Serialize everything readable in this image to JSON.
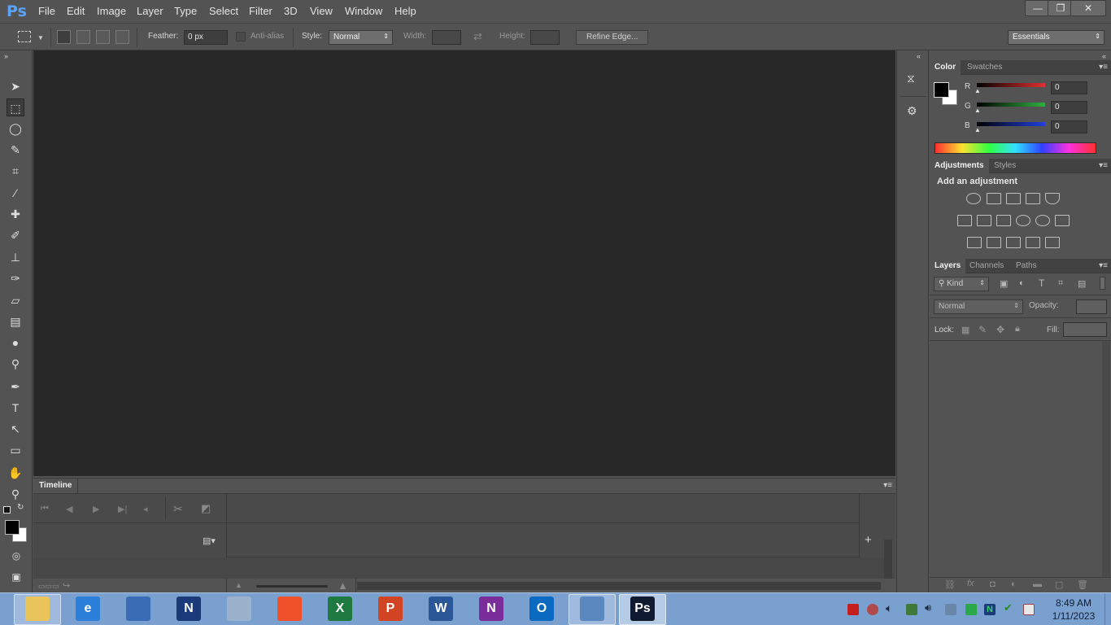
{
  "app": {
    "logo_text": "Ps"
  },
  "menu": [
    "File",
    "Edit",
    "Image",
    "Layer",
    "Type",
    "Select",
    "Filter",
    "3D",
    "View",
    "Window",
    "Help"
  ],
  "window_controls": {
    "minimize": "—",
    "restore": "❐",
    "close": "✕"
  },
  "options_bar": {
    "feather_label": "Feather:",
    "feather_value": "0 px",
    "antialias_label": "Anti-alias",
    "style_label": "Style:",
    "style_value": "Normal",
    "width_label": "Width:",
    "height_label": "Height:",
    "refine_edge": "Refine Edge...",
    "workspace": "Essentials"
  },
  "tools": [
    {
      "name": "move-tool-icon",
      "glyph": "➤"
    },
    {
      "name": "rect-marquee-tool-icon",
      "glyph": "⬚"
    },
    {
      "name": "lasso-tool-icon",
      "glyph": "◯"
    },
    {
      "name": "quick-select-tool-icon",
      "glyph": "✎"
    },
    {
      "name": "crop-tool-icon",
      "glyph": "⌗"
    },
    {
      "name": "eyedropper-tool-icon",
      "glyph": "⁄"
    },
    {
      "name": "healing-brush-tool-icon",
      "glyph": "✚"
    },
    {
      "name": "brush-tool-icon",
      "glyph": "✐"
    },
    {
      "name": "clone-stamp-tool-icon",
      "glyph": "⊥"
    },
    {
      "name": "history-brush-tool-icon",
      "glyph": "✑"
    },
    {
      "name": "eraser-tool-icon",
      "glyph": "▱"
    },
    {
      "name": "gradient-tool-icon",
      "glyph": "▤"
    },
    {
      "name": "blur-tool-icon",
      "glyph": "●"
    },
    {
      "name": "dodge-tool-icon",
      "glyph": "⚲"
    },
    {
      "name": "pen-tool-icon",
      "glyph": "✒"
    },
    {
      "name": "type-tool-icon",
      "glyph": "T"
    },
    {
      "name": "path-select-tool-icon",
      "glyph": "↖"
    },
    {
      "name": "shape-tool-icon",
      "glyph": "▭"
    },
    {
      "name": "hand-tool-icon",
      "glyph": "✋"
    },
    {
      "name": "zoom-tool-icon",
      "glyph": "⚲"
    }
  ],
  "timeline": {
    "tab": "Timeline",
    "controls": [
      "⏮",
      "◀",
      "▶",
      "▶|",
      "◂",
      "✂",
      "◩"
    ],
    "add": "+"
  },
  "color_panel": {
    "tabs": [
      "Color",
      "Swatches"
    ],
    "channels": [
      {
        "label": "R",
        "value": "0",
        "color": "#e03030"
      },
      {
        "label": "G",
        "value": "0",
        "color": "#30b040"
      },
      {
        "label": "B",
        "value": "0",
        "color": "#2040e0"
      }
    ]
  },
  "adjustments_panel": {
    "tabs": [
      "Adjustments",
      "Styles"
    ],
    "heading": "Add an adjustment"
  },
  "layers_panel": {
    "tabs": [
      "Layers",
      "Channels",
      "Paths"
    ],
    "filter": "Kind",
    "blend_mode": "Normal",
    "opacity_label": "Opacity:",
    "lock_label": "Lock:",
    "fill_label": "Fill:"
  },
  "taskbar": {
    "apps": [
      {
        "name": "file-explorer",
        "label": "",
        "color": "#e8c45a"
      },
      {
        "name": "internet-explorer",
        "label": "e",
        "color": "#2b7fd8"
      },
      {
        "name": "network-app",
        "label": "",
        "color": "#3a6bb5"
      },
      {
        "name": "n-app",
        "label": "N",
        "color": "#1a3a7a"
      },
      {
        "name": "computer-app",
        "label": "",
        "color": "#9ab2cc"
      },
      {
        "name": "brave",
        "label": "",
        "color": "#f0502a"
      },
      {
        "name": "excel",
        "label": "X",
        "color": "#1e7a40"
      },
      {
        "name": "powerpoint",
        "label": "P",
        "color": "#d04423"
      },
      {
        "name": "word",
        "label": "W",
        "color": "#2b5797"
      },
      {
        "name": "onenote",
        "label": "N",
        "color": "#7a2c9a"
      },
      {
        "name": "outlook",
        "label": "O",
        "color": "#0a6ac2"
      },
      {
        "name": "remote-app",
        "label": "",
        "color": "#5c88c0"
      },
      {
        "name": "photoshop",
        "label": "Ps",
        "color": "#0f1a30"
      }
    ],
    "clock_time": "8:49 AM",
    "clock_date": "1/11/2023"
  }
}
